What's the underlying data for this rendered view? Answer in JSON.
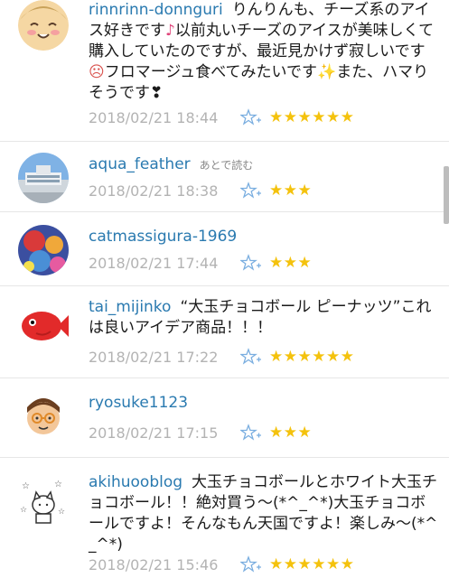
{
  "comments": [
    {
      "username": "rinnrinn-donnguri",
      "text_part1": "りんりんも、チーズ系のアイス好きです",
      "text_part2": "以前丸いチーズのアイスが美味しくて購入していたのですが、最近見かけず寂しいです",
      "text_part3": "フロマージュ食べてみたいです",
      "text_part4": "また、ハマりそうです",
      "timestamp": "2018/02/21 18:44",
      "stars": "★★★★★★",
      "star_count": 6
    },
    {
      "username": "aqua_feather",
      "read_later": "あとで読む",
      "timestamp": "2018/02/21 18:38",
      "stars": "★★★",
      "star_count": 3
    },
    {
      "username": "catmassigura-1969",
      "timestamp": "2018/02/21 17:44",
      "stars": "★★★",
      "star_count": 3
    },
    {
      "username": "tai_mijinko",
      "text": "“大玉チョコボール ピーナッツ”これは良いアイデア商品！！！",
      "timestamp": "2018/02/21 17:22",
      "stars": "★★★★★★",
      "star_count": 6
    },
    {
      "username": "ryosuke1123",
      "timestamp": "2018/02/21 17:15",
      "stars": "★★★",
      "star_count": 3
    },
    {
      "username": "akihuooblog",
      "text": "大玉チョコボールとホワイト大玉チョコボール！！絶対買う〜(*^_^*)大玉チョコボールですよ！そんなもん天国ですよ！楽しみ〜(*^_^*)",
      "timestamp": "2018/02/21 15:46",
      "stars": "★★★★★★",
      "star_count": 6
    }
  ],
  "colors": {
    "username": "#2a7ab0",
    "timestamp": "#b3b3b3",
    "star": "#f4c20d",
    "add_star": "#7aaee0"
  },
  "icons": {
    "add_star": "add-star-icon",
    "note": "music-note-icon",
    "sad": "sad-face-icon",
    "sparkle": "sparkle-icon",
    "heart": "heart-icon"
  }
}
